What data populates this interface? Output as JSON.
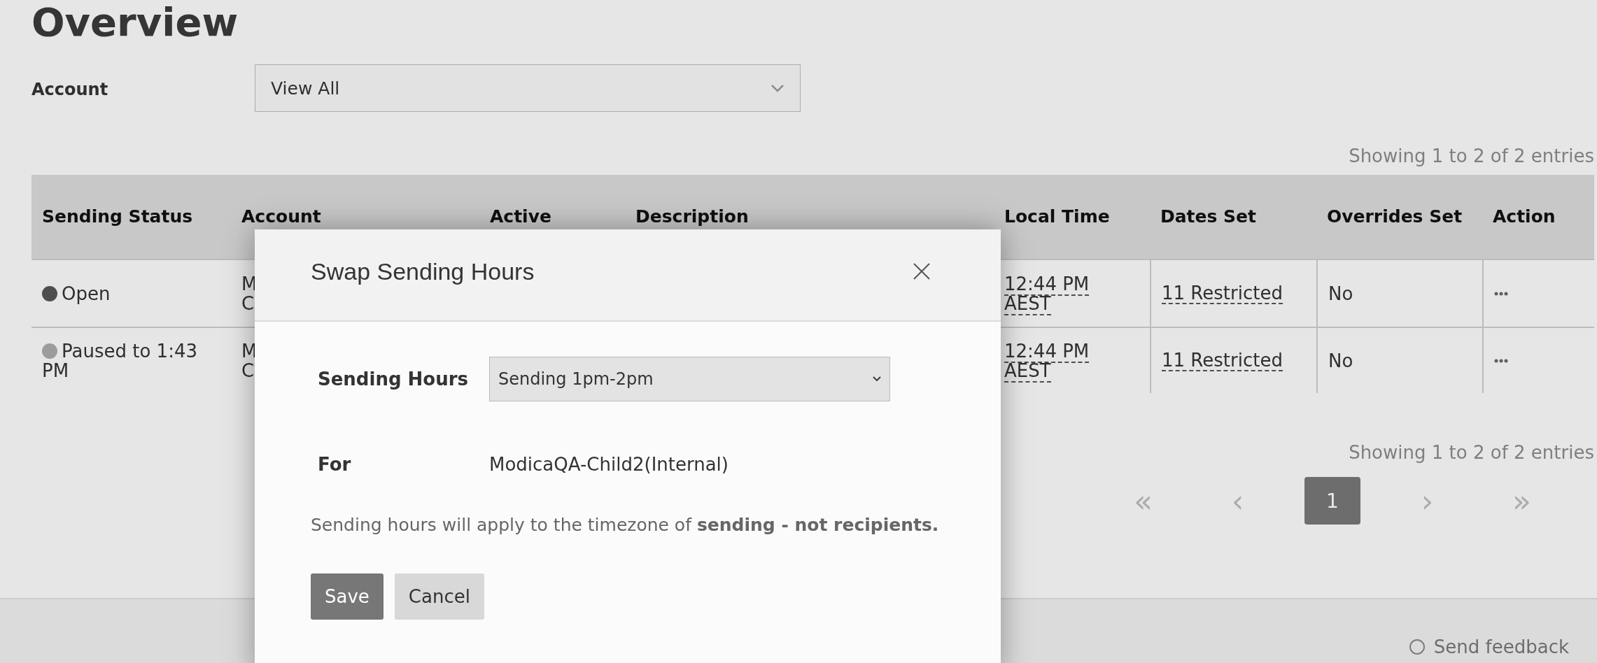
{
  "page": {
    "title": "Overview"
  },
  "filter": {
    "label": "Account",
    "value": "View All"
  },
  "summary_top": "Showing 1 to 2 of 2 entries",
  "table": {
    "columns": [
      "Sending Status",
      "Account",
      "Active",
      "Description",
      "Local Time",
      "Dates Set",
      "Overrides Set",
      "Action"
    ],
    "rows": [
      {
        "status": "Open",
        "color": "#555555",
        "account": [
          "M",
          "C"
        ],
        "local_time": [
          "12:44 PM",
          "AEST"
        ],
        "dates_set": "11 Restricted",
        "overrides_set": "No"
      },
      {
        "status": "Paused to 1:43 PM",
        "color": "#aaaaaa",
        "account": [
          "M",
          "C"
        ],
        "local_time": [
          "12:44 PM",
          "AEST"
        ],
        "dates_set": "11 Restricted",
        "overrides_set": "No"
      }
    ]
  },
  "summary_bottom": "Showing 1 to 2 of 2 entries",
  "pagination": [
    {
      "label": "«",
      "selected": false
    },
    {
      "label": "‹",
      "selected": false
    },
    {
      "label": "1",
      "selected": true
    },
    {
      "label": "›",
      "selected": false
    },
    {
      "label": "»",
      "selected": false
    }
  ],
  "footer": {
    "link": "Send feedback"
  },
  "dialog": {
    "title": "Swap Sending Hours",
    "fields": [
      {
        "kind": "select",
        "label": "Sending Hours",
        "value": "Sending 1pm-2pm"
      },
      {
        "kind": "text",
        "label": "For",
        "value": "ModicaQA-Child2(Internal)"
      }
    ],
    "note": "Sending hours will apply to the timezone of **sending - not recipients.**",
    "buttons": [
      {
        "label": "Save",
        "kind": "primary"
      },
      {
        "label": "Cancel",
        "kind": "secondary"
      }
    ]
  }
}
